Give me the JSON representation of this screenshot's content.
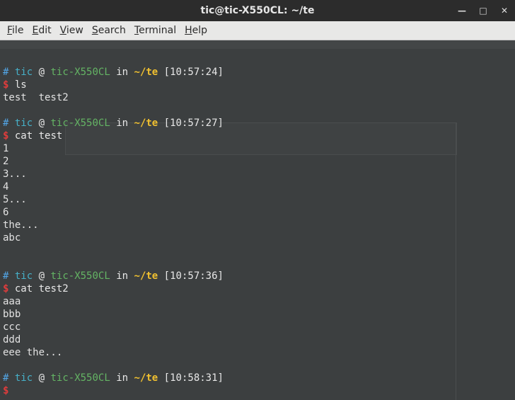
{
  "window": {
    "title": "tic@tic-X550CL: ~/te",
    "controls": {
      "minimize": "—",
      "maximize": "□",
      "close": "✕"
    }
  },
  "menu": {
    "items": [
      {
        "label_first": "F",
        "label_rest": "ile"
      },
      {
        "label_first": "E",
        "label_rest": "dit"
      },
      {
        "label_first": "V",
        "label_rest": "iew"
      },
      {
        "label_first": "S",
        "label_rest": "earch"
      },
      {
        "label_first": "T",
        "label_rest": "erminal"
      },
      {
        "label_first": "H",
        "label_rest": "elp"
      }
    ]
  },
  "prompt": {
    "hash": "#",
    "user": "tic",
    "at": "@",
    "host": "tic-X550CL",
    "in": "in",
    "path": "~/te",
    "dollar": "$"
  },
  "blocks": [
    {
      "time": "[10:57:24]",
      "command": "ls",
      "output": [
        "test  test2"
      ]
    },
    {
      "time": "[10:57:27]",
      "command": "cat test",
      "output": [
        "1",
        "2",
        "3...",
        "4",
        "5...",
        "6",
        "the...",
        "abc",
        ""
      ]
    },
    {
      "time": "[10:57:36]",
      "command": "cat test2",
      "output": [
        "aaa",
        "bbb",
        "ccc",
        "ddd",
        "eee the..."
      ]
    },
    {
      "time": "[10:58:31]",
      "command": "",
      "output": []
    }
  ],
  "colors": {
    "user": "#46b0c8",
    "host": "#64b464",
    "path": "#f0c030",
    "dollar": "#e03c3c",
    "hash": "#52a6e6"
  }
}
